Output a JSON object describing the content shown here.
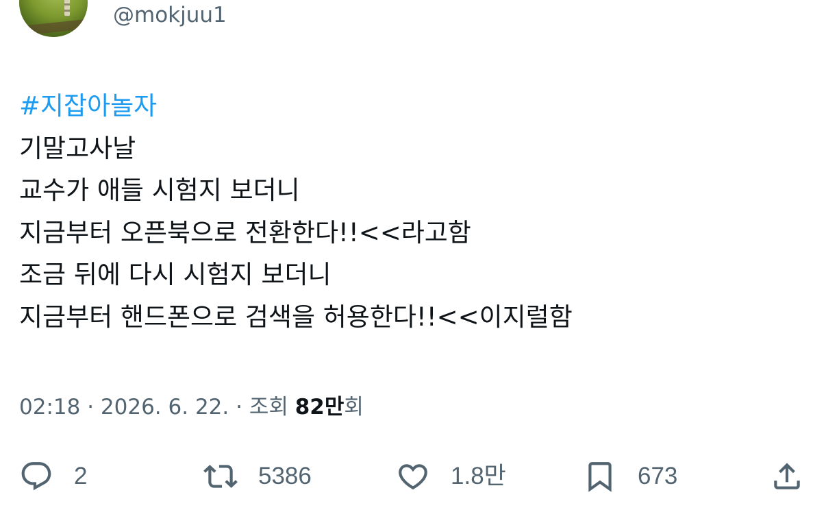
{
  "author": {
    "handle": "@mokjuu1"
  },
  "tweet": {
    "hashtag": "#지잡아놀자",
    "lines": [
      "기말고사날",
      "교수가 애들 시험지 보더니",
      "지금부터 오픈북으로 전환한다!!<<라고함",
      "조금 뒤에 다시 시험지 보더니",
      "지금부터 핸드폰으로 검색을 허용한다!!<<이지럴함"
    ]
  },
  "meta": {
    "time": "02:18",
    "sep1": " · ",
    "date": "2026. 6. 22.",
    "sep2": " · ",
    "views_label": "조회 ",
    "views_num": "82만",
    "views_suffix": "회"
  },
  "actions": {
    "reply": {
      "icon": "reply-icon",
      "count": "2"
    },
    "retweet": {
      "icon": "retweet-icon",
      "count": "5386"
    },
    "like": {
      "icon": "heart-icon",
      "count": "1.8만"
    },
    "bookmark": {
      "icon": "bookmark-icon",
      "count": "673"
    },
    "share": {
      "icon": "share-icon"
    }
  },
  "colors": {
    "text": "#0f1419",
    "secondary": "#536471",
    "link": "#1d9bf0"
  }
}
